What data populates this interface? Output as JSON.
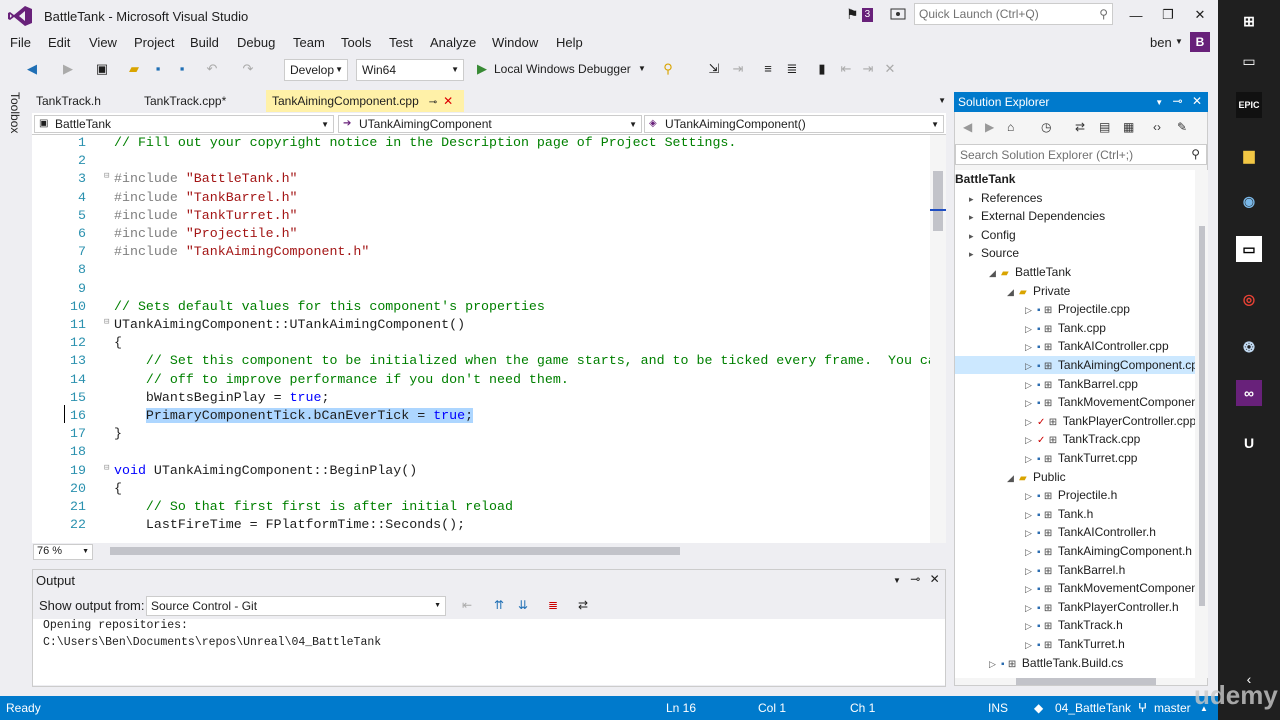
{
  "window": {
    "title": "BattleTank - Microsoft Visual Studio",
    "notification_count": "3",
    "quick_launch_placeholder": "Quick Launch (Ctrl+Q)",
    "user": "ben",
    "user_initial": "B"
  },
  "menu": [
    "File",
    "Edit",
    "View",
    "Project",
    "Build",
    "Debug",
    "Team",
    "Tools",
    "Test",
    "Analyze",
    "Window",
    "Help"
  ],
  "toolbar": {
    "configuration": "Develop",
    "platform": "Win64",
    "debugger": "Local Windows Debugger"
  },
  "sidebar": {
    "toolbox_label": "Toolbox"
  },
  "tabs": [
    {
      "label": "TankTrack.h"
    },
    {
      "label": "TankTrack.cpp*"
    },
    {
      "label": "TankAimingComponent.cpp",
      "active": true
    }
  ],
  "navbar": {
    "project": "BattleTank",
    "class": "UTankAimingComponent",
    "member": "UTankAimingComponent()"
  },
  "editor": {
    "zoom": "76 %",
    "lines": [
      {
        "n": "1",
        "text": "// Fill out your copyright notice in the Description page of Project Settings."
      },
      {
        "n": "2",
        "text": ""
      },
      {
        "n": "3",
        "text": "#include \"BattleTank.h\""
      },
      {
        "n": "4",
        "text": "#include \"TankBarrel.h\""
      },
      {
        "n": "5",
        "text": "#include \"TankTurret.h\""
      },
      {
        "n": "6",
        "text": "#include \"Projectile.h\""
      },
      {
        "n": "7",
        "text": "#include \"TankAimingComponent.h\""
      },
      {
        "n": "8",
        "text": ""
      },
      {
        "n": "9",
        "text": ""
      },
      {
        "n": "10",
        "text": "// Sets default values for this component's properties"
      },
      {
        "n": "11",
        "text": "UTankAimingComponent::UTankAimingComponent()"
      },
      {
        "n": "12",
        "text": "{"
      },
      {
        "n": "13",
        "text": "    // Set this component to be initialized when the game starts, and to be ticked every frame.  You ca"
      },
      {
        "n": "14",
        "text": "    // off to improve performance if you don't need them."
      },
      {
        "n": "15",
        "text": "    bWantsBeginPlay = true;"
      },
      {
        "n": "16",
        "text": "    PrimaryComponentTick.bCanEverTick = true;"
      },
      {
        "n": "17",
        "text": "}"
      },
      {
        "n": "18",
        "text": ""
      },
      {
        "n": "19",
        "text": "void UTankAimingComponent::BeginPlay()"
      },
      {
        "n": "20",
        "text": "{"
      },
      {
        "n": "21",
        "text": "    // So that first first is after initial reload"
      },
      {
        "n": "22",
        "text": "    LastFireTime = FPlatformTime::Seconds();"
      }
    ]
  },
  "output": {
    "title": "Output",
    "show_from_label": "Show output from:",
    "source": "Source Control - Git",
    "lines": [
      "Opening repositories:",
      "C:\\Users\\Ben\\Documents\\repos\\Unreal\\04_BattleTank"
    ]
  },
  "solution_explorer": {
    "title": "Solution Explorer",
    "search_placeholder": "Search Solution Explorer (Ctrl+;)",
    "items": [
      {
        "label": "BattleTank",
        "level": 0,
        "bold": true
      },
      {
        "label": "References",
        "level": 1
      },
      {
        "label": "External Dependencies",
        "level": 1
      },
      {
        "label": "Config",
        "level": 1
      },
      {
        "label": "Source",
        "level": 1
      },
      {
        "label": "BattleTank",
        "level": 2
      },
      {
        "label": "Private",
        "level": 3
      },
      {
        "label": "Projectile.cpp",
        "level": 4,
        "state": "lock"
      },
      {
        "label": "Tank.cpp",
        "level": 4,
        "state": "lock"
      },
      {
        "label": "TankAIController.cpp",
        "level": 4,
        "state": "lock"
      },
      {
        "label": "TankAimingComponent.cpp",
        "level": 4,
        "state": "lock",
        "selected": true
      },
      {
        "label": "TankBarrel.cpp",
        "level": 4,
        "state": "lock"
      },
      {
        "label": "TankMovementComponent.cpp",
        "level": 4,
        "state": "lock"
      },
      {
        "label": "TankPlayerController.cpp",
        "level": 4,
        "state": "mod"
      },
      {
        "label": "TankTrack.cpp",
        "level": 4,
        "state": "mod"
      },
      {
        "label": "TankTurret.cpp",
        "level": 4,
        "state": "lock"
      },
      {
        "label": "Public",
        "level": 3
      },
      {
        "label": "Projectile.h",
        "level": 4,
        "state": "lock"
      },
      {
        "label": "Tank.h",
        "level": 4,
        "state": "lock"
      },
      {
        "label": "TankAIController.h",
        "level": 4,
        "state": "lock"
      },
      {
        "label": "TankAimingComponent.h",
        "level": 4,
        "state": "lock"
      },
      {
        "label": "TankBarrel.h",
        "level": 4,
        "state": "lock"
      },
      {
        "label": "TankMovementComponent.h",
        "level": 4,
        "state": "lock"
      },
      {
        "label": "TankPlayerController.h",
        "level": 4,
        "state": "lock"
      },
      {
        "label": "TankTrack.h",
        "level": 4,
        "state": "lock"
      },
      {
        "label": "TankTurret.h",
        "level": 4,
        "state": "lock"
      },
      {
        "label": "BattleTank.Build.cs",
        "level": 2,
        "state": "lock"
      }
    ]
  },
  "status": {
    "state": "Ready",
    "line": "Ln 16",
    "col": "Col 1",
    "ch": "Ch 1",
    "mode": "INS",
    "repo": "04_BattleTank",
    "branch": "master"
  },
  "watermark": "udemy",
  "colors": {
    "accent": "#007acc",
    "vs_purple": "#68217a",
    "tab_active": "#fff1a8",
    "selection": "#add6ff"
  }
}
